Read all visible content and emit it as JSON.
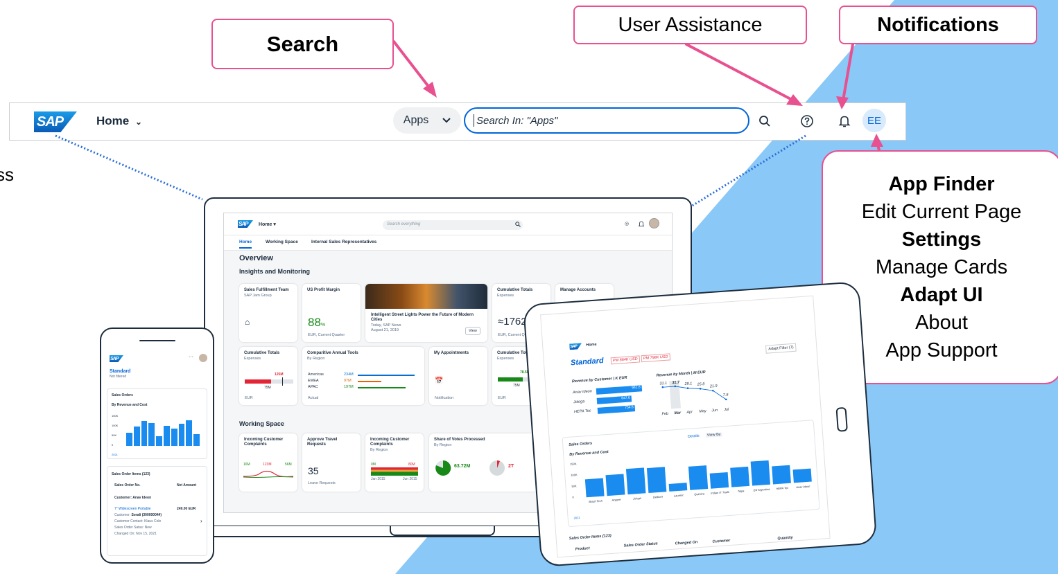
{
  "colors": {
    "accent": "#0064d9",
    "callout_border": "#e8508f",
    "background_wedge": "#8ac8f7",
    "positive": "#188918",
    "negative": "#e32636"
  },
  "callouts": {
    "search": "Search",
    "user_assistance": "User Assistance",
    "notifications": "Notifications",
    "menu": [
      "App Finder",
      "Edit Current Page",
      "Settings",
      "Manage Cards",
      "Adapt UI",
      "About",
      "App Support"
    ],
    "edge_text": [
      "ss",
      ""
    ]
  },
  "shellbar": {
    "logo": "SAP",
    "home": "Home",
    "apps": "Apps",
    "search_value": "Search In: \"Apps\"",
    "avatar": "EE",
    "icons": [
      "search-icon",
      "help-icon",
      "bell-icon"
    ]
  },
  "laptop": {
    "logo": "SAP",
    "home": "Home",
    "search_placeholder": "Search everything",
    "tabs": [
      "Home",
      "Working Space",
      "Internal Sales Representatives"
    ],
    "overview": "Overview",
    "section1": "Insights and Monitoring",
    "section2": "Working Space",
    "cards": {
      "c1": {
        "title": "Sales Fulfillment Team",
        "sub": "SAP Jam Group"
      },
      "c2": {
        "title": "US Profit Margin",
        "value": "88",
        "unit": "%",
        "sub": "EUR, Current Quarter"
      },
      "c3": {
        "title": "Intelligent Street Lights Power the Future of Modern Cities",
        "sub": "Today, SAP News",
        "date": "August 21, 2019",
        "button": "View"
      },
      "c4": {
        "title": "Cumulative Totals",
        "sub": "Expenses",
        "value": "1762",
        "foot": "EUR, Current Quarter"
      },
      "c5": {
        "title": "Manage Accounts"
      },
      "c6": {
        "title": "Cumulative Totals",
        "sub": "Expenses",
        "target": "125M",
        "actual": "75M",
        "foot": "EUR"
      },
      "c7": {
        "title": "Comparitive Annual Tools",
        "sub": "By Region",
        "rows": [
          {
            "label": "Americas",
            "value": "234M",
            "fraction": 0.95
          },
          {
            "label": "EMEA",
            "value": "97M",
            "fraction": 0.4
          },
          {
            "label": "APAC",
            "value": "197M",
            "fraction": 0.8
          }
        ],
        "foot": "Actual"
      },
      "c8": {
        "title": "My Appointments",
        "foot": "Notification"
      },
      "c9": {
        "title": "Cumulative Totals",
        "sub": "Expenses",
        "target": "78.5M",
        "actual": "75M",
        "foot": "EUR"
      },
      "w1": {
        "title": "Incoming Customer Complaints",
        "labels": [
          "16M",
          "123M",
          "56M"
        ]
      },
      "w2": {
        "title": "Approve Travel Requests",
        "value": "35",
        "foot": "Leave Requests"
      },
      "w3": {
        "title": "Incoming Customer Complaints",
        "sub": "By Region",
        "labels": [
          "0M",
          "80M"
        ],
        "dates": [
          "Jan 2015",
          "Jun 2015"
        ]
      },
      "w4": {
        "title": "Share of Votes Processed",
        "sub": "By Region",
        "value1": "63.72M",
        "value2": "2T"
      }
    }
  },
  "phone": {
    "logo": "SAP",
    "variant": "Standard",
    "sub": "Not filtered",
    "card1": "Sales Orders",
    "card1_sub": "By Revenue and Cost",
    "yticks": [
      "150K",
      "100K",
      "50K",
      "0"
    ],
    "legend": "2021",
    "bars": [
      0.42,
      0.6,
      0.78,
      0.72,
      0.3,
      0.62,
      0.54,
      0.7,
      0.8,
      0.36
    ],
    "card2": "Sales Order Items (123)",
    "col1": "Sales Order No.",
    "col2": "Net Amount",
    "group": "Customer: Anav Ideon",
    "item": {
      "name": "7\" Widescreen Portable",
      "amount": "249.00",
      "currency": "EUR",
      "customer_label": "Customer:",
      "customer": "Sorali (300000044)",
      "contact_label": "Customer Contact:",
      "contact": "Klaus Cole",
      "status_label": "Sales Order Satus:",
      "status": "New",
      "changed_label": "Changed On:",
      "changed": "Nov 15, 2021"
    }
  },
  "tablet": {
    "logo": "SAP",
    "home": "Home",
    "variant": "Standard",
    "tags": [
      "PM 864K USD",
      "PM 798K USD"
    ],
    "adapt": "Adapt Filter (7)",
    "chart1": {
      "title": "Revenue by Customer | K EUR",
      "rows": [
        {
          "label": "Anav Ideon",
          "value": "941.8"
        },
        {
          "label": "Jologa",
          "value": "647.6"
        },
        {
          "label": "HEPA Tec",
          "value": "754.6"
        }
      ]
    },
    "chart2": {
      "title": "Revenue by Month | M EUR",
      "values": [
        "31.1",
        "31.7",
        "28.1",
        "25.8",
        "21.9",
        "7.8"
      ],
      "months": [
        "Feb",
        "Mar",
        "Apr",
        "May",
        "Jun",
        "Jul"
      ]
    },
    "card": {
      "title": "Sales Orders",
      "sub": "By Revenue and Cost",
      "details": "Details",
      "viewby": "View By",
      "yticks": [
        "150K",
        "100K",
        "50K",
        "0"
      ],
      "legend": "2021",
      "bars": [
        0.55,
        0.62,
        0.78,
        0.75,
        0.22,
        0.7,
        0.45,
        0.58,
        0.72,
        0.55,
        0.4
      ],
      "cats": [
        "Brazil Tech",
        "Angeré",
        "Jologa",
        "Delbont",
        "Laurent",
        "Quimica",
        "Indian IT Trade",
        "Talpa",
        "EN Argentina",
        "HEPA Tec",
        "Anav Ideon"
      ]
    },
    "items": {
      "title": "Sales Order Items (123)",
      "cols": [
        "Product",
        "Sales Order Status",
        "Changed On",
        "Customer",
        "Quantity"
      ]
    }
  }
}
